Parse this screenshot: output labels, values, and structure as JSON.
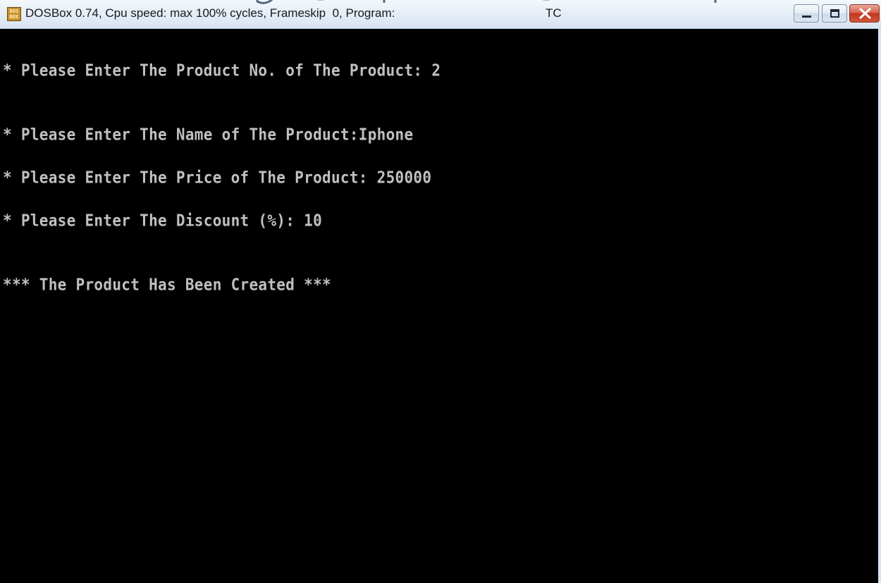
{
  "window": {
    "title": "DOSBox 0.74, Cpu speed: max 100% cycles, Frameskip  0, Program:",
    "program": "TC",
    "icon": "dosbox-icon",
    "icon_text_top": "DOS",
    "icon_text_bottom": "BOX",
    "controls": [
      "minimize",
      "maximize",
      "close"
    ]
  },
  "console": {
    "lines": [
      "* Please Enter The Product No. of The Product: 2",
      "* Please Enter The Name of The Product:Iphone",
      "* Please Enter The Price of The Product: 250000",
      "* Please Enter The Discount (%): 10",
      "*** The Product Has Been Created ***"
    ]
  },
  "colors": {
    "console_background": "#000000",
    "console_text": "#c0c0c0",
    "close_button": "#c4361c"
  }
}
